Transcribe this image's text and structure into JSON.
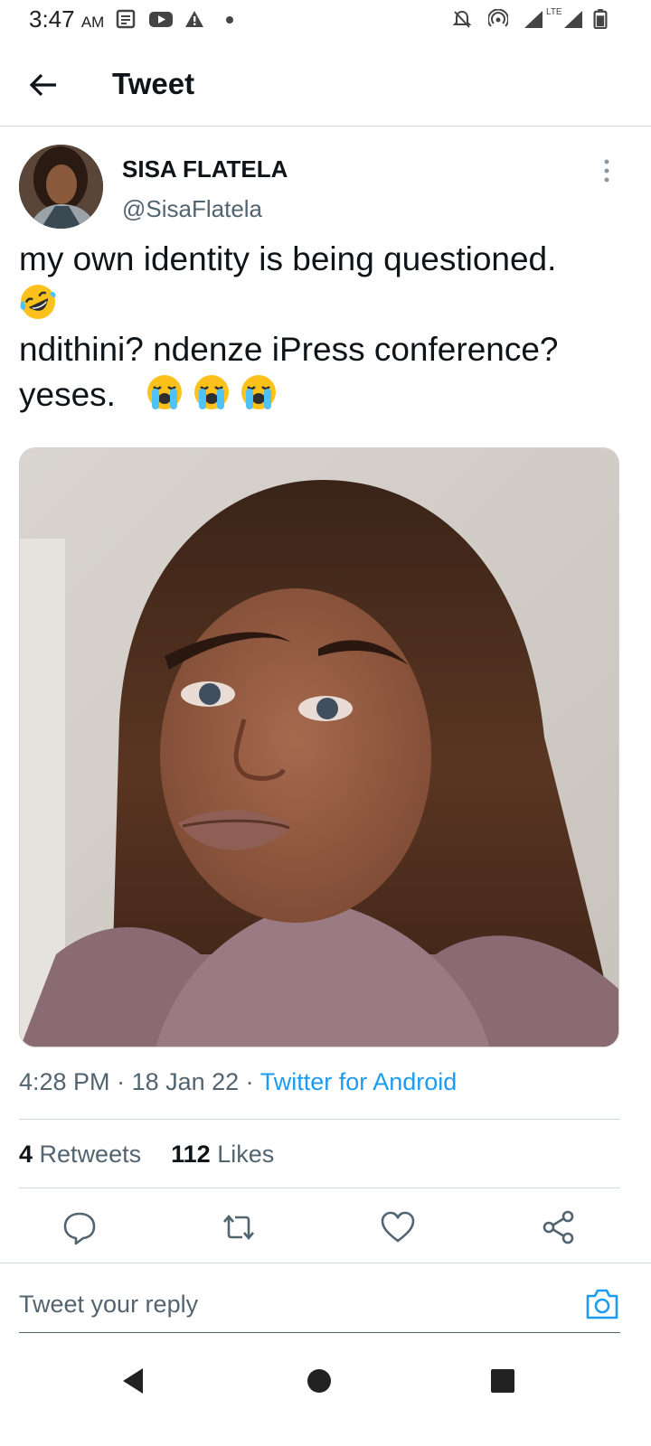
{
  "status_bar": {
    "time": "3:47",
    "ampm": "AM",
    "network": "LTE"
  },
  "header": {
    "title": "Tweet"
  },
  "tweet": {
    "name": "SISA FLATELA",
    "handle": "@SisaFlatela",
    "line1": "my own identity is being questioned.",
    "line2": "ndithini? ndenze iPress conference?",
    "line3": "yeses.",
    "time": "4:28 PM",
    "date": "18 Jan 22",
    "source": "Twitter for Android",
    "retweets_count": "4",
    "retweets_label": "Retweets",
    "likes_count": "112",
    "likes_label": "Likes"
  },
  "reply": {
    "placeholder": "Tweet your reply"
  },
  "colors": {
    "accent": "#1d9bf0",
    "muted": "#536471",
    "text": "#0f1419"
  }
}
